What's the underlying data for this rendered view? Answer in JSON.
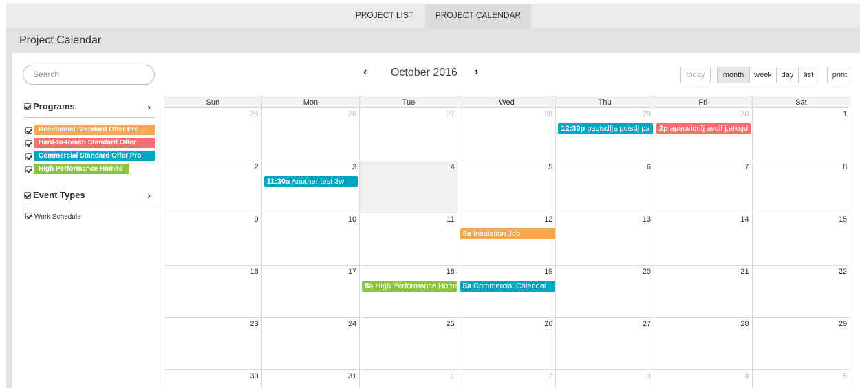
{
  "tabs": [
    {
      "label": "PROJECT LIST",
      "active": false
    },
    {
      "label": "PROJECT CALENDAR",
      "active": true
    }
  ],
  "page_title": "Project Calendar",
  "search": {
    "placeholder": "Search"
  },
  "programs": {
    "header": "Programs",
    "items": [
      {
        "label": "Residential Standard Offer Pro ...",
        "color": "#f7a64a"
      },
      {
        "label": "Hard-to-Reach Standard Offer",
        "color": "#f46f6f"
      },
      {
        "label": "Commercial Standard Offer Pro",
        "color": "#00a5c2"
      },
      {
        "label": "High Performance Homes",
        "color": "#8cc63f"
      }
    ]
  },
  "event_types": {
    "header": "Event Types",
    "items": [
      {
        "label": "Work Schedule"
      }
    ]
  },
  "toolbar": {
    "prev_icon": "‹",
    "next_icon": "›",
    "title": "October 2016",
    "today": "today",
    "month": "month",
    "week": "week",
    "day": "day",
    "list": "list",
    "print": "print"
  },
  "weekdays": [
    "Sun",
    "Mon",
    "Tue",
    "Wed",
    "Thu",
    "Fri",
    "Sat"
  ],
  "weeks": [
    [
      "25",
      "26",
      "27",
      "28",
      "29",
      "30",
      "1"
    ],
    [
      "2",
      "3",
      "4",
      "5",
      "6",
      "7",
      "8"
    ],
    [
      "9",
      "10",
      "11",
      "12",
      "13",
      "14",
      "15"
    ],
    [
      "16",
      "17",
      "18",
      "19",
      "20",
      "21",
      "22"
    ],
    [
      "23",
      "24",
      "25",
      "26",
      "27",
      "28",
      "29"
    ],
    [
      "30",
      "31",
      "1",
      "2",
      "3",
      "4",
      "5"
    ]
  ],
  "events": [
    {
      "time": "12:30p",
      "title": "paoisdfja poisdj pa",
      "color": "#00a5c2"
    },
    {
      "time": "2p",
      "title": "apaosidufj asdif j;alksjd",
      "color": "#f46f6f"
    },
    {
      "time": "11:30a",
      "title": "Another test 3w",
      "color": "#00a5c2"
    },
    {
      "time": "8a",
      "title": "Insulation Job",
      "color": "#f7a64a"
    },
    {
      "time": "8a",
      "title": "High Performance Homes",
      "color": "#8cc63f"
    },
    {
      "time": "8a",
      "title": "Commercial Calendar",
      "color": "#00a5c2"
    }
  ]
}
